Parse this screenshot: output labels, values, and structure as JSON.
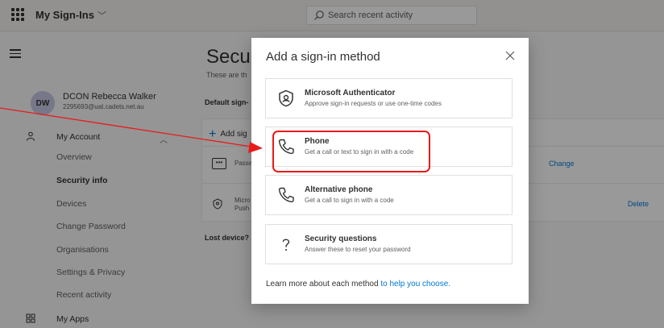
{
  "topbar": {
    "app_title": "My Sign-Ins",
    "search_placeholder": "Search recent activity"
  },
  "sidebar": {
    "user": {
      "initials": "DW",
      "name": "DCON Rebecca Walker",
      "email": "2295693@uat.cadets.net.au"
    },
    "section": "My Account",
    "items": [
      {
        "label": "Overview"
      },
      {
        "label": "Security info",
        "active": true
      },
      {
        "label": "Devices"
      },
      {
        "label": "Change Password"
      },
      {
        "label": "Organisations"
      },
      {
        "label": "Settings & Privacy"
      },
      {
        "label": "Recent activity"
      }
    ],
    "apps_label": "My Apps"
  },
  "main": {
    "title": "Securi",
    "subtitle": "These are th",
    "default_label": "Default sign-",
    "add_label": "Add sig",
    "password_label": "Passw",
    "change_link": "Change",
    "auth_label1": "Micro",
    "auth_label2": "Push",
    "delete_link": "Delete",
    "lost_device": "Lost device? S"
  },
  "dialog": {
    "title": "Add a sign-in method",
    "methods": [
      {
        "title": "Microsoft Authenticator",
        "description": "Approve sign-in requests or use one-time codes",
        "icon": "authenticator-icon"
      },
      {
        "title": "Phone",
        "description": "Get a call or text to sign in with a code",
        "icon": "phone-icon"
      },
      {
        "title": "Alternative phone",
        "description": "Get a call to sign in with a code",
        "icon": "phone-icon"
      },
      {
        "title": "Security questions",
        "description": "Answer these to reset your password",
        "icon": "question-icon"
      }
    ],
    "learn_more_prefix": "Learn more about each method ",
    "learn_more_link": "to help you choose."
  },
  "colors": {
    "accent": "#0078d4",
    "annotation": "#e81b1b",
    "overlay": "rgba(0,0,0,0.40)"
  }
}
